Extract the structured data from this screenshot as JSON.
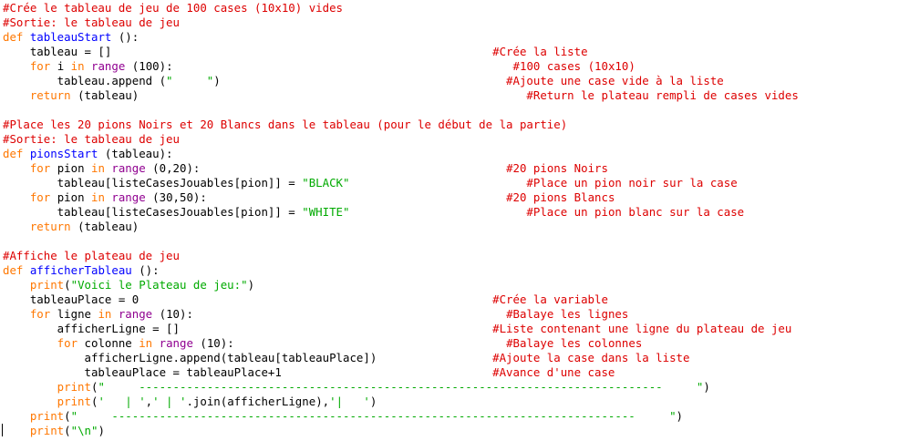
{
  "theme": {
    "comment": "#dd0000",
    "keyword": "#ff7700",
    "builtin": "#900090",
    "defname": "#0000ff",
    "string": "#00aa00",
    "plain": "#000000"
  },
  "lines": [
    [
      [
        "c",
        "#Crée le tableau de jeu de 100 cases (10x10) vides"
      ]
    ],
    [
      [
        "c",
        "#Sortie: le tableau de jeu"
      ]
    ],
    [
      [
        "k",
        "def "
      ],
      [
        "d",
        "tableauStart"
      ],
      [
        "p",
        " ():"
      ]
    ],
    [
      [
        "p",
        "    tableau = []                                                        "
      ],
      [
        "c",
        "#Crée la liste"
      ]
    ],
    [
      [
        "k",
        "    for "
      ],
      [
        "p",
        "i "
      ],
      [
        "k",
        "in "
      ],
      [
        "b",
        "range"
      ],
      [
        "p",
        " (100):                                                  "
      ],
      [
        "c",
        "#100 cases (10x10)"
      ]
    ],
    [
      [
        "p",
        "        tableau.append ("
      ],
      [
        "s",
        "\"     \""
      ],
      [
        "p",
        ")                                          "
      ],
      [
        "c",
        "#Ajoute une case vide à la liste"
      ]
    ],
    [
      [
        "k",
        "    return "
      ],
      [
        "p",
        "(tableau)                                                         "
      ],
      [
        "c",
        "#Return le plateau rempli de cases vides"
      ]
    ],
    [
      [
        "p",
        ""
      ]
    ],
    [
      [
        "c",
        "#Place les 20 pions Noirs et 20 Blancs dans le tableau (pour le début de la partie)"
      ]
    ],
    [
      [
        "c",
        "#Sortie: le tableau de jeu"
      ]
    ],
    [
      [
        "k",
        "def "
      ],
      [
        "d",
        "pionsStart"
      ],
      [
        "p",
        " (tableau):"
      ]
    ],
    [
      [
        "k",
        "    for "
      ],
      [
        "p",
        "pion "
      ],
      [
        "k",
        "in "
      ],
      [
        "b",
        "range"
      ],
      [
        "p",
        " (0,20):                                             "
      ],
      [
        "c",
        "#20 pions Noirs"
      ]
    ],
    [
      [
        "p",
        "        tableau[listeCasesJouables[pion]] = "
      ],
      [
        "s",
        "\"BLACK\""
      ],
      [
        "p",
        "                          "
      ],
      [
        "c",
        "#Place un pion noir sur la case"
      ]
    ],
    [
      [
        "k",
        "    for "
      ],
      [
        "p",
        "pion "
      ],
      [
        "k",
        "in "
      ],
      [
        "b",
        "range"
      ],
      [
        "p",
        " (30,50):                                            "
      ],
      [
        "c",
        "#20 pions Blancs"
      ]
    ],
    [
      [
        "p",
        "        tableau[listeCasesJouables[pion]] = "
      ],
      [
        "s",
        "\"WHITE\""
      ],
      [
        "p",
        "                          "
      ],
      [
        "c",
        "#Place un pion blanc sur la case"
      ]
    ],
    [
      [
        "k",
        "    return "
      ],
      [
        "p",
        "(tableau)"
      ]
    ],
    [
      [
        "p",
        ""
      ]
    ],
    [
      [
        "c",
        "#Affiche le plateau de jeu"
      ]
    ],
    [
      [
        "k",
        "def "
      ],
      [
        "d",
        "afficherTableau"
      ],
      [
        "p",
        " ():"
      ]
    ],
    [
      [
        "k",
        "    print"
      ],
      [
        "p",
        "("
      ],
      [
        "s",
        "\"Voici le Plateau de jeu:\""
      ],
      [
        "p",
        ")"
      ]
    ],
    [
      [
        "p",
        "    tableauPlace = 0                                                    "
      ],
      [
        "c",
        "#Crée la variable"
      ]
    ],
    [
      [
        "k",
        "    for "
      ],
      [
        "p",
        "ligne "
      ],
      [
        "k",
        "in "
      ],
      [
        "b",
        "range"
      ],
      [
        "p",
        " (10):                                              "
      ],
      [
        "c",
        "#Balaye les lignes"
      ]
    ],
    [
      [
        "p",
        "        afficherLigne = []                                              "
      ],
      [
        "c",
        "#Liste contenant une ligne du plateau de jeu"
      ]
    ],
    [
      [
        "k",
        "        for "
      ],
      [
        "p",
        "colonne "
      ],
      [
        "k",
        "in "
      ],
      [
        "b",
        "range"
      ],
      [
        "p",
        " (10):                                        "
      ],
      [
        "c",
        "#Balaye les colonnes"
      ]
    ],
    [
      [
        "p",
        "            afficherLigne.append(tableau[tableauPlace])                 "
      ],
      [
        "c",
        "#Ajoute la case dans la liste"
      ]
    ],
    [
      [
        "p",
        "            tableauPlace = tableauPlace+1                               "
      ],
      [
        "c",
        "#Avance d'une case"
      ]
    ],
    [
      [
        "k",
        "        print"
      ],
      [
        "p",
        "("
      ],
      [
        "s",
        "\"     -----------------------------------------------------------------------------     \""
      ],
      [
        "p",
        ")"
      ]
    ],
    [
      [
        "k",
        "        print"
      ],
      [
        "p",
        "("
      ],
      [
        "s",
        "'   | '"
      ],
      [
        "p",
        ","
      ],
      [
        "s",
        "' | '"
      ],
      [
        "p",
        ".join(afficherLigne),"
      ],
      [
        "s",
        "'|   '"
      ],
      [
        "p",
        ")"
      ]
    ],
    [
      [
        "k",
        "    print"
      ],
      [
        "p",
        "("
      ],
      [
        "s",
        "\"     -----------------------------------------------------------------------------     \""
      ],
      [
        "p",
        ")"
      ]
    ],
    [
      [
        "k",
        "    print"
      ],
      [
        "p",
        "("
      ],
      [
        "s",
        "\"\\n\""
      ],
      [
        "p",
        ")"
      ]
    ]
  ]
}
